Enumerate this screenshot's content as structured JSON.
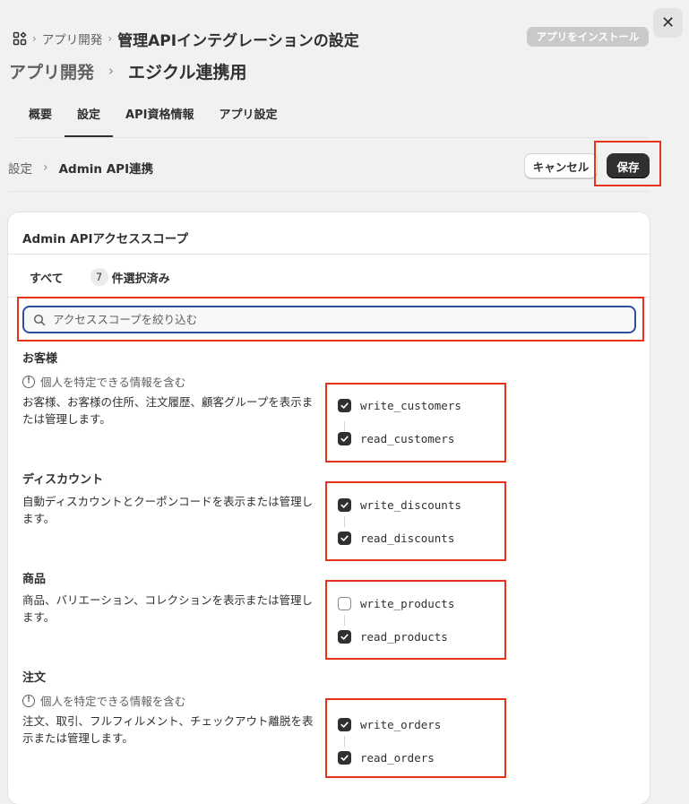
{
  "header": {
    "breadcrumb": [
      "アプリ開発"
    ],
    "page_title": "管理APIインテグレーションの設定",
    "install_label": "アプリをインストール",
    "close_label": "✕"
  },
  "app": {
    "parent": "アプリ開発",
    "name": "エジクル連携用"
  },
  "tabs": [
    {
      "label": "概要"
    },
    {
      "label": "設定"
    },
    {
      "label": "API資格情報"
    },
    {
      "label": "アプリ設定"
    }
  ],
  "subbar": {
    "crumb_parent": "設定",
    "crumb_current": "Admin API連携",
    "cancel_label": "キャンセル",
    "save_label": "保存"
  },
  "card": {
    "title": "Admin APIアクセススコープ",
    "filter_all": "すべて",
    "selected_count": "7",
    "selected_label": "件選択済み",
    "search_placeholder": "アクセススコープを絞り込む"
  },
  "sections": [
    {
      "title": "お客様",
      "pii": "個人を特定できる情報を含む",
      "desc": "お客様、お客様の住所、注文履歴、顧客グループを表示または管理します。",
      "scopes": [
        {
          "name": "write_customers",
          "checked": true
        },
        {
          "name": "read_customers",
          "checked": true
        }
      ]
    },
    {
      "title": "ディスカウント",
      "pii": "",
      "desc": "自動ディスカウントとクーポンコードを表示または管理します。",
      "scopes": [
        {
          "name": "write_discounts",
          "checked": true
        },
        {
          "name": "read_discounts",
          "checked": true
        }
      ]
    },
    {
      "title": "商品",
      "pii": "",
      "desc": "商品、バリエーション、コレクションを表示または管理します。",
      "scopes": [
        {
          "name": "write_products",
          "checked": false
        },
        {
          "name": "read_products",
          "checked": true
        }
      ]
    },
    {
      "title": "注文",
      "pii": "個人を特定できる情報を含む",
      "desc": "注文、取引、フルフィルメント、チェックアウト離脱を表示または管理します。",
      "scopes": [
        {
          "name": "write_orders",
          "checked": true
        },
        {
          "name": "read_orders",
          "checked": true
        }
      ]
    }
  ],
  "colors": {
    "highlight": "#e8321a",
    "primary_button": "#303030",
    "focus_ring": "#2c4f9e"
  }
}
